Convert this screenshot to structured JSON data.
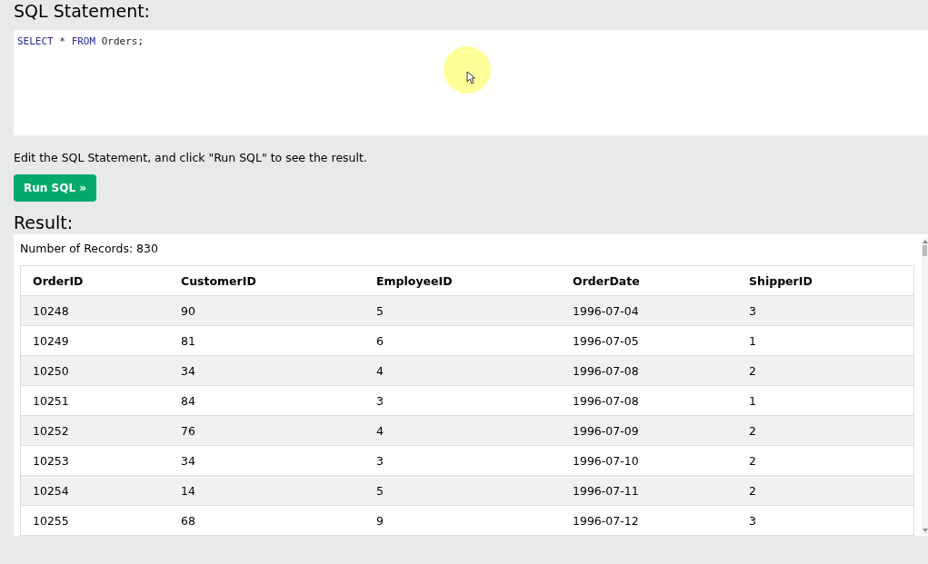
{
  "sql_statement": {
    "heading": "SQL Statement:",
    "code": [
      {
        "text": "SELECT",
        "kind": "keyword"
      },
      {
        "text": " * ",
        "kind": "plain"
      },
      {
        "text": "FROM",
        "kind": "keyword"
      },
      {
        "text": " Orders;",
        "kind": "plain"
      }
    ]
  },
  "instruction": "Edit the SQL Statement, and click \"Run SQL\" to see the result.",
  "run_button": "Run SQL »",
  "result": {
    "heading": "Result:",
    "record_count": "Number of Records: 830",
    "table": {
      "columns": [
        "OrderID",
        "CustomerID",
        "EmployeeID",
        "OrderDate",
        "ShipperID"
      ],
      "rows": [
        [
          "10248",
          "90",
          "5",
          "1996-07-04",
          "3"
        ],
        [
          "10249",
          "81",
          "6",
          "1996-07-05",
          "1"
        ],
        [
          "10250",
          "34",
          "4",
          "1996-07-08",
          "2"
        ],
        [
          "10251",
          "84",
          "3",
          "1996-07-08",
          "1"
        ],
        [
          "10252",
          "76",
          "4",
          "1996-07-09",
          "2"
        ],
        [
          "10253",
          "34",
          "3",
          "1996-07-10",
          "2"
        ],
        [
          "10254",
          "14",
          "5",
          "1996-07-11",
          "2"
        ],
        [
          "10255",
          "68",
          "9",
          "1996-07-12",
          "3"
        ]
      ]
    }
  }
}
